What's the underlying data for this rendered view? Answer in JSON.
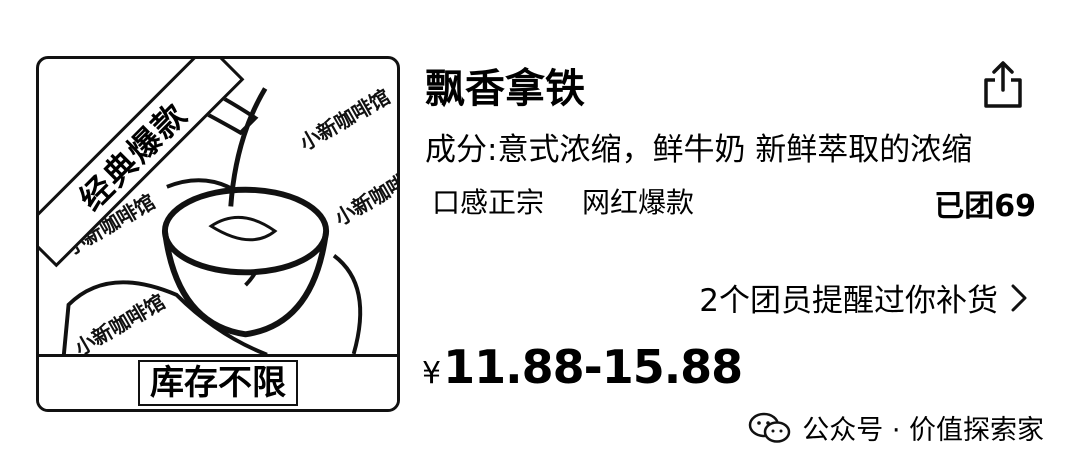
{
  "product": {
    "title": "飘香拿铁",
    "description": "成分:意式浓缩，鲜牛奶 新鲜萃取的浓缩",
    "tags": [
      "口感正宗",
      "网红爆款"
    ],
    "grouped_count": "已团69",
    "reminder": "2个团员提醒过你补货",
    "price_currency": "¥",
    "price_range": "11.88-15.88"
  },
  "image": {
    "ribbon_label": "经典爆款",
    "stock_label": "库存不限",
    "watermark_text": "小新咖啡馆"
  },
  "footer": {
    "source": "公众号 · 价值探索家"
  },
  "icons": {
    "share": "share-icon",
    "chevron": "chevron-right-icon",
    "wechat": "wechat-icon"
  }
}
